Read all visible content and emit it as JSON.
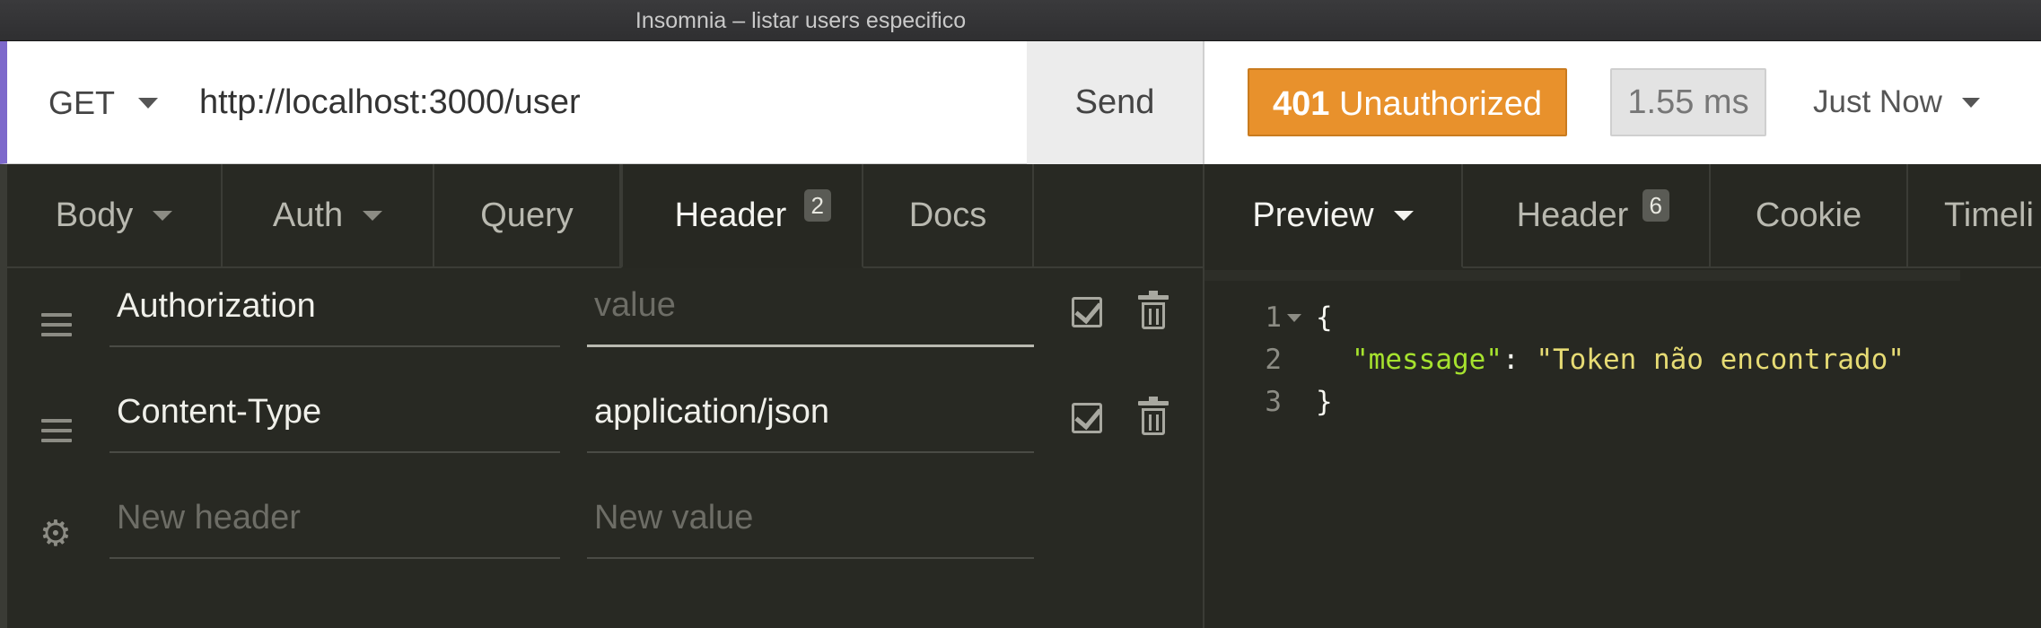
{
  "window": {
    "title": "Insomnia – listar users especifico"
  },
  "request": {
    "method": "GET",
    "url": "http://localhost:3000/user",
    "send_label": "Send"
  },
  "response": {
    "status_code": "401",
    "status_text": "Unauthorized",
    "time": "1.55 ms",
    "when": "Just Now"
  },
  "request_tabs": [
    {
      "label": "Body",
      "has_caret": true
    },
    {
      "label": "Auth",
      "has_caret": true
    },
    {
      "label": "Query"
    },
    {
      "label": "Header",
      "badge": "2",
      "active": true
    },
    {
      "label": "Docs"
    }
  ],
  "headers": [
    {
      "name": "Authorization",
      "value": "",
      "value_placeholder": "value"
    },
    {
      "name": "Content-Type",
      "value": "application/json"
    }
  ],
  "new_header": {
    "name_placeholder": "New header",
    "value_placeholder": "New value"
  },
  "response_tabs": [
    {
      "label": "Preview",
      "active": true
    },
    {
      "label": "Header",
      "badge": "6"
    },
    {
      "label": "Cookie"
    },
    {
      "label": "Timeli"
    }
  ],
  "body": {
    "lines": [
      {
        "num": "1",
        "open": "{"
      },
      {
        "num": "2",
        "key": "\"message\"",
        "colon": ": ",
        "value": "\"Token não encontrado\""
      },
      {
        "num": "3",
        "close": "}"
      }
    ]
  },
  "icons": {
    "drag": "drag-handle-icon",
    "settings": "gear-icon",
    "enabled": "checkbox-checked-icon",
    "delete": "trash-icon"
  },
  "colors": {
    "status_error": "#e8912c",
    "json_key": "#a6e22e",
    "json_string": "#e6db74",
    "accent": "#7d69cb"
  }
}
